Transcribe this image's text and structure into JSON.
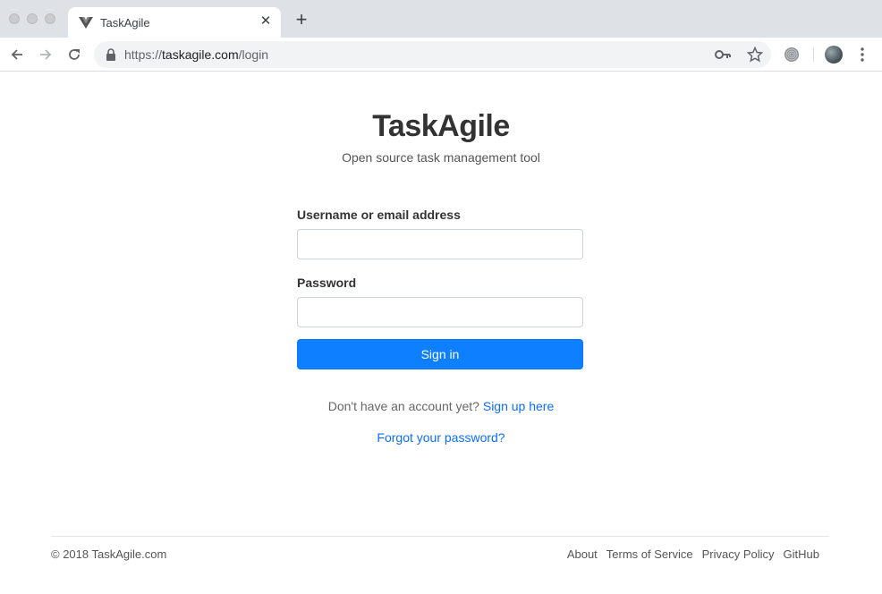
{
  "browser": {
    "tab": {
      "title": "TaskAgile",
      "favicon": "vue-logo-icon"
    },
    "address_bar": {
      "scheme": "https://",
      "host": "taskagile.com",
      "path": "/login"
    }
  },
  "header": {
    "logo_text": "TaskAgile",
    "tagline": "Open source task management tool"
  },
  "form": {
    "username_label": "Username or email address",
    "username_value": "",
    "password_label": "Password",
    "password_value": "",
    "submit_label": "Sign in",
    "accent_color": "#0d7fff"
  },
  "links": {
    "signup_prompt": "Don't have an account yet?",
    "signup_link": "Sign up here",
    "forgot_link": "Forgot your password?"
  },
  "footer": {
    "copyright": "© 2018 TaskAgile.com",
    "links": [
      "About",
      "Terms of Service",
      "Privacy Policy",
      "GitHub"
    ]
  }
}
